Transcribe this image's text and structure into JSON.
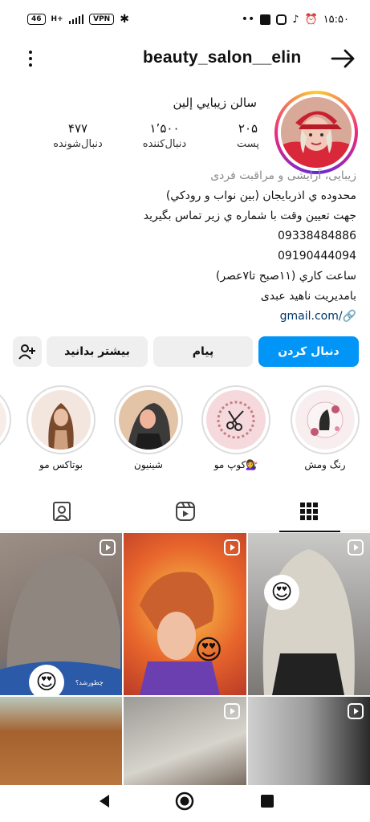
{
  "status_bar": {
    "battery": "46",
    "network": "H+",
    "vpn": "VPN",
    "time": "۱۵:۵۰"
  },
  "header": {
    "username": "beauty_salon__elin",
    "more_icon": "vertical-dots-icon",
    "back_icon": "arrow-right-icon"
  },
  "profile": {
    "full_name": "سالن زيبايي إلين",
    "stats": [
      {
        "value": "۲۰۵",
        "label": "پست"
      },
      {
        "value": "۱٬۵۰۰",
        "label": "دنبال‌کننده"
      },
      {
        "value": "۴۷۷",
        "label": "دنبال‌شونده"
      }
    ],
    "bio": {
      "category": "زیبایی، آرایشی و مراقبت فردی",
      "lines": [
        "محدوده ي اذربايجان (بين نواب و رودكي)",
        "جهت تعيين وقت با شماره ي زير تماس بگيريد",
        "09338484886",
        "09190444094",
        "ساعت كاري (۱۱صبح تا۷عصر)",
        "بامديريت ناهيد عبدی"
      ],
      "link": "gmail.com/"
    }
  },
  "actions": {
    "follow": "دنبال کردن",
    "message": "پیام",
    "more": "بیشتر بدانید",
    "add_user_icon": "add-user-icon"
  },
  "highlights": [
    {
      "caption": "رنگ ومش"
    },
    {
      "caption": "کوپ مو💇‍♀️"
    },
    {
      "caption": "شينيون"
    },
    {
      "caption": "بوتاكس مو"
    }
  ],
  "tabs": [
    {
      "icon": "grid-icon",
      "active": true
    },
    {
      "icon": "reels-icon",
      "active": false
    },
    {
      "icon": "tagged-icon",
      "active": false
    }
  ],
  "posts": [
    {
      "emoji": "😍",
      "reel": true,
      "overlay_text": "چطورشد؟"
    },
    {
      "emoji": "😍",
      "reel": true
    },
    {
      "emoji": "😍",
      "reel": true
    },
    {
      "reel": false
    },
    {
      "reel": true
    },
    {
      "reel": true
    }
  ],
  "colors": {
    "accent": "#0095f6",
    "link": "#00376b"
  }
}
